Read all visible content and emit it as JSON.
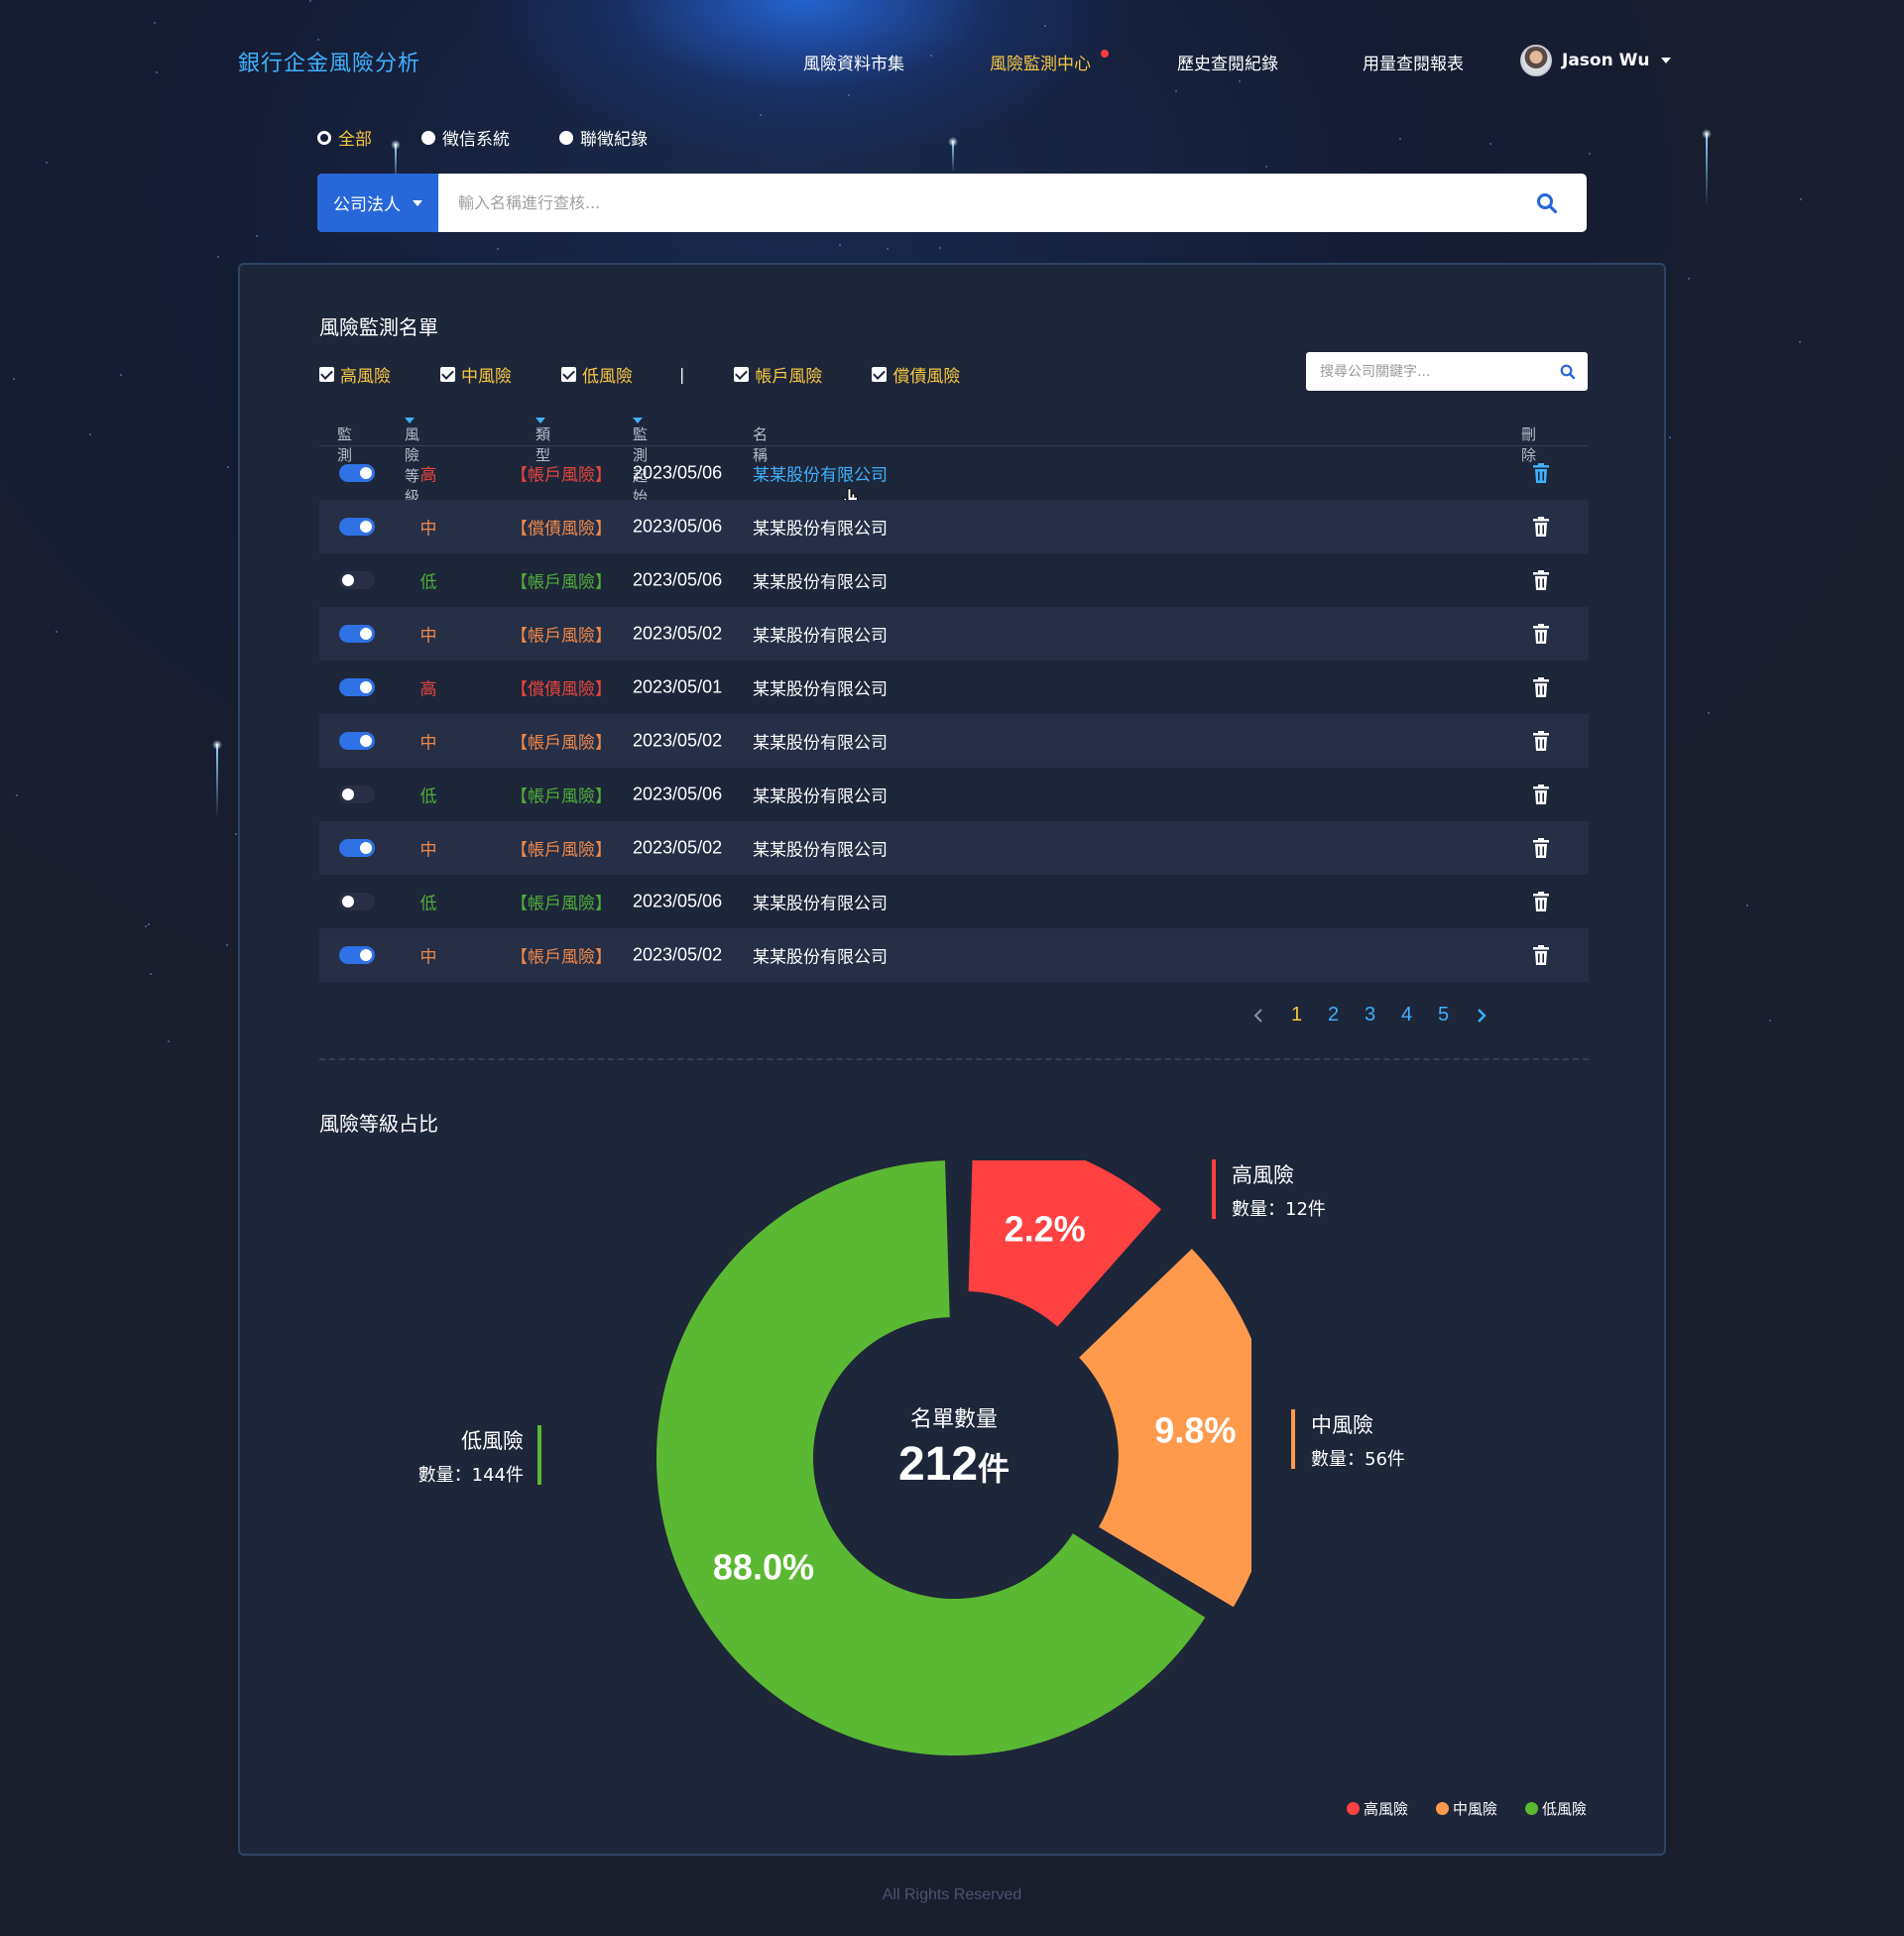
{
  "header": {
    "brand": "銀行企金風險分析",
    "nav": [
      {
        "label": "風險資料市集",
        "active": false
      },
      {
        "label": "風險監測中心",
        "active": true
      },
      {
        "label": "歷史查閱紀錄",
        "active": false
      },
      {
        "label": "用量查閱報表",
        "active": false
      }
    ],
    "user_name": "Jason Wu"
  },
  "search": {
    "scopes": [
      {
        "label": "全部",
        "selected": true
      },
      {
        "label": "徵信系統",
        "selected": false
      },
      {
        "label": "聯徵紀錄",
        "selected": false
      }
    ],
    "type_select": "公司法人",
    "placeholder": "輸入名稱進行查核..."
  },
  "monitor": {
    "title": "風險監測名單",
    "filters": [
      "高風險",
      "中風險",
      "低風險",
      "帳戶風險",
      "償債風險"
    ],
    "separator": "|",
    "keyword_placeholder": "搜尋公司關鍵字...",
    "columns": {
      "monitor": "監測",
      "level": "風險等級",
      "type": "類型",
      "start_date": "監測起始日",
      "name": "名稱",
      "delete": "刪除"
    },
    "rows": [
      {
        "on": true,
        "level": "高",
        "level_key": "high",
        "type": "【帳戶風險】",
        "type_key": "high",
        "date": "2023/05/06",
        "name": "某某股份有限公司",
        "hover": true
      },
      {
        "on": true,
        "level": "中",
        "level_key": "mid",
        "type": "【償債風險】",
        "type_key": "mid",
        "date": "2023/05/06",
        "name": "某某股份有限公司",
        "hover": false
      },
      {
        "on": false,
        "level": "低",
        "level_key": "low",
        "type": "【帳戶風險】",
        "type_key": "low",
        "date": "2023/05/06",
        "name": "某某股份有限公司",
        "hover": false
      },
      {
        "on": true,
        "level": "中",
        "level_key": "mid",
        "type": "【帳戶風險】",
        "type_key": "mid",
        "date": "2023/05/02",
        "name": "某某股份有限公司",
        "hover": false
      },
      {
        "on": true,
        "level": "高",
        "level_key": "high",
        "type": "【償債風險】",
        "type_key": "high",
        "date": "2023/05/01",
        "name": "某某股份有限公司",
        "hover": false
      },
      {
        "on": true,
        "level": "中",
        "level_key": "mid",
        "type": "【帳戶風險】",
        "type_key": "mid",
        "date": "2023/05/02",
        "name": "某某股份有限公司",
        "hover": false
      },
      {
        "on": false,
        "level": "低",
        "level_key": "low",
        "type": "【帳戶風險】",
        "type_key": "low",
        "date": "2023/05/06",
        "name": "某某股份有限公司",
        "hover": false
      },
      {
        "on": true,
        "level": "中",
        "level_key": "mid",
        "type": "【帳戶風險】",
        "type_key": "mid",
        "date": "2023/05/02",
        "name": "某某股份有限公司",
        "hover": false
      },
      {
        "on": false,
        "level": "低",
        "level_key": "low",
        "type": "【帳戶風險】",
        "type_key": "low",
        "date": "2023/05/06",
        "name": "某某股份有限公司",
        "hover": false
      },
      {
        "on": true,
        "level": "中",
        "level_key": "mid",
        "type": "【帳戶風險】",
        "type_key": "mid",
        "date": "2023/05/02",
        "name": "某某股份有限公司",
        "hover": false
      }
    ],
    "pagination": {
      "pages": [
        "1",
        "2",
        "3",
        "4",
        "5"
      ],
      "current": "1"
    }
  },
  "ratio": {
    "title": "風險等級占比",
    "center_label": "名單數量",
    "center_value": "212",
    "center_unit": "件"
  },
  "chart_data": {
    "type": "pie",
    "donut": true,
    "categories": [
      "高風險",
      "中風險",
      "低風險"
    ],
    "values": [
      12,
      56,
      144
    ],
    "percent_labels": [
      "2.2%",
      "9.8%",
      "88.0%"
    ],
    "count_labels": [
      "數量：12件",
      "數量：56件",
      "數量：144件"
    ],
    "colors": [
      "#ff4141",
      "#ff9a4d",
      "#5bb832"
    ],
    "legend_position": "bottom-right"
  },
  "footer": "All Rights Reserved"
}
